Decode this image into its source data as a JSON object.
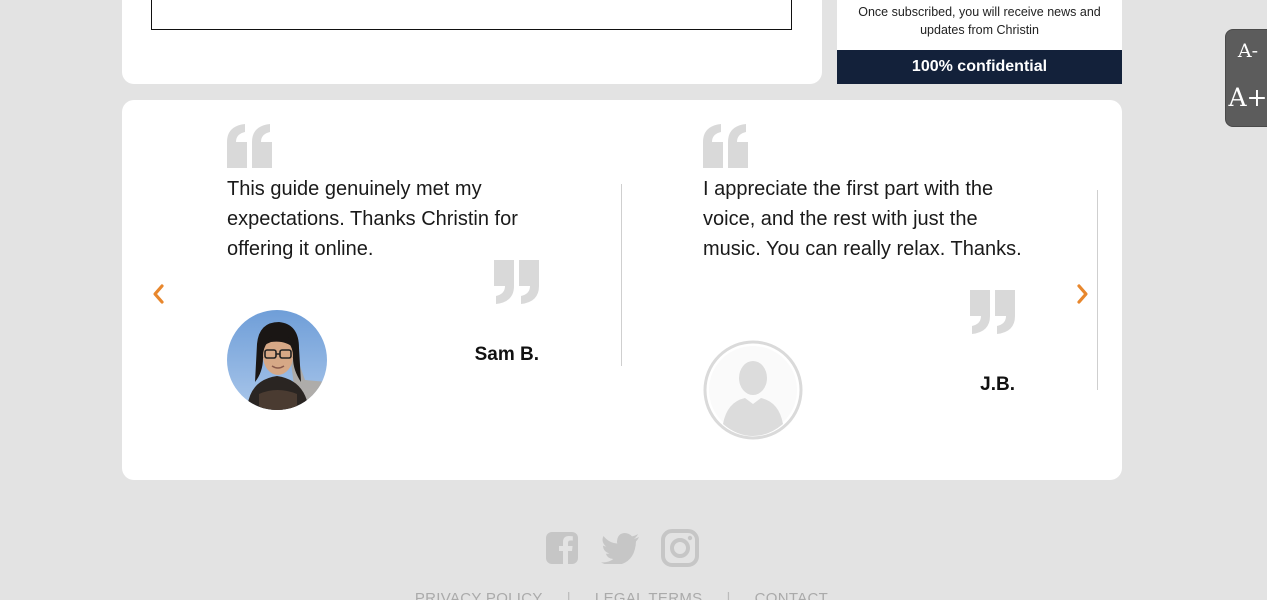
{
  "subscribe": {
    "note": "Once subscribed, you will receive news and updates from Christin",
    "confidential": "100% confidential"
  },
  "font_widget": {
    "decrease_label": "A-",
    "increase_label": "A+"
  },
  "testimonials": [
    {
      "text": "This guide genuinely met my expectations. Thanks Christin for offering it online.",
      "author": "Sam B."
    },
    {
      "text": "I appreciate the first part with the voice, and the rest with just the music. You can really relax. Thanks.",
      "author": "J.B."
    }
  ],
  "footer": {
    "social": [
      "facebook-icon",
      "twitter-icon",
      "instagram-icon"
    ],
    "links": [
      "PRIVACY POLICY",
      "LEGAL TERMS",
      "CONTACT"
    ],
    "separator": "|"
  },
  "colors": {
    "accent_orange": "#e8872d",
    "navy": "#13213a",
    "quote_gray": "#d9d9d9"
  }
}
